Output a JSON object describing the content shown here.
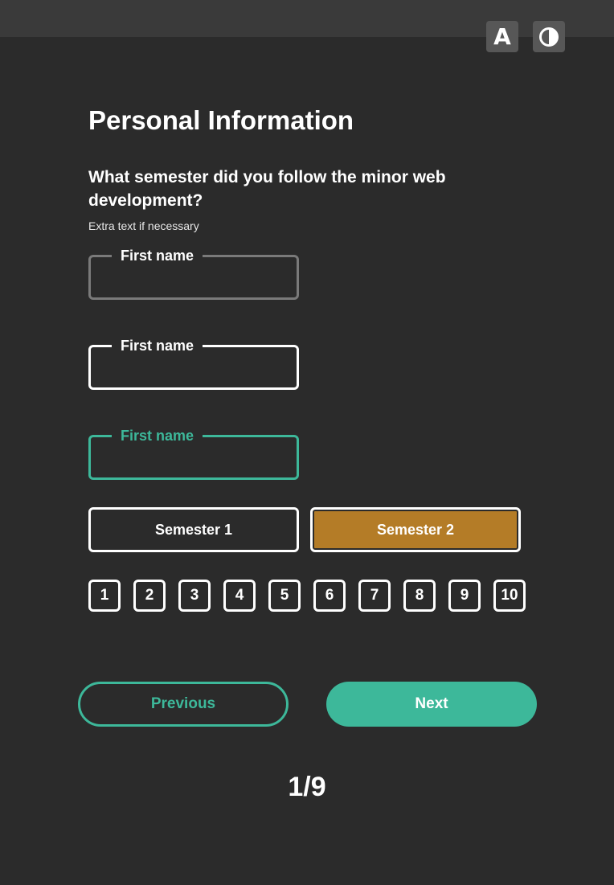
{
  "toolbar": {
    "font_button_glyph": "A",
    "font_button_icon": "font-size-icon",
    "contrast_button_icon": "contrast-icon"
  },
  "page": {
    "title": "Personal Information",
    "question": "What semester did you follow the minor web development?",
    "helper_text": "Extra text if necessary"
  },
  "fields": [
    {
      "label": "First name",
      "state": "disabled",
      "value": "",
      "placeholder": ""
    },
    {
      "label": "First name",
      "state": "default",
      "value": "",
      "placeholder": ""
    },
    {
      "label": "First name",
      "state": "focused",
      "value": "",
      "placeholder": ""
    }
  ],
  "semesters": [
    {
      "label": "Semester 1",
      "selected": false
    },
    {
      "label": "Semester 2",
      "selected": true
    }
  ],
  "ratings": [
    "1",
    "2",
    "3",
    "4",
    "5",
    "6",
    "7",
    "8",
    "9",
    "10"
  ],
  "navigation": {
    "previous_label": "Previous",
    "next_label": "Next"
  },
  "progress": {
    "text": "1/9",
    "current": 1,
    "total": 9
  },
  "colors": {
    "background": "#2b2b2b",
    "topbar": "#3a3a3a",
    "accent_teal": "#3db89a",
    "selected_orange": "#b47c27",
    "disabled_border": "#7a7a7a"
  }
}
